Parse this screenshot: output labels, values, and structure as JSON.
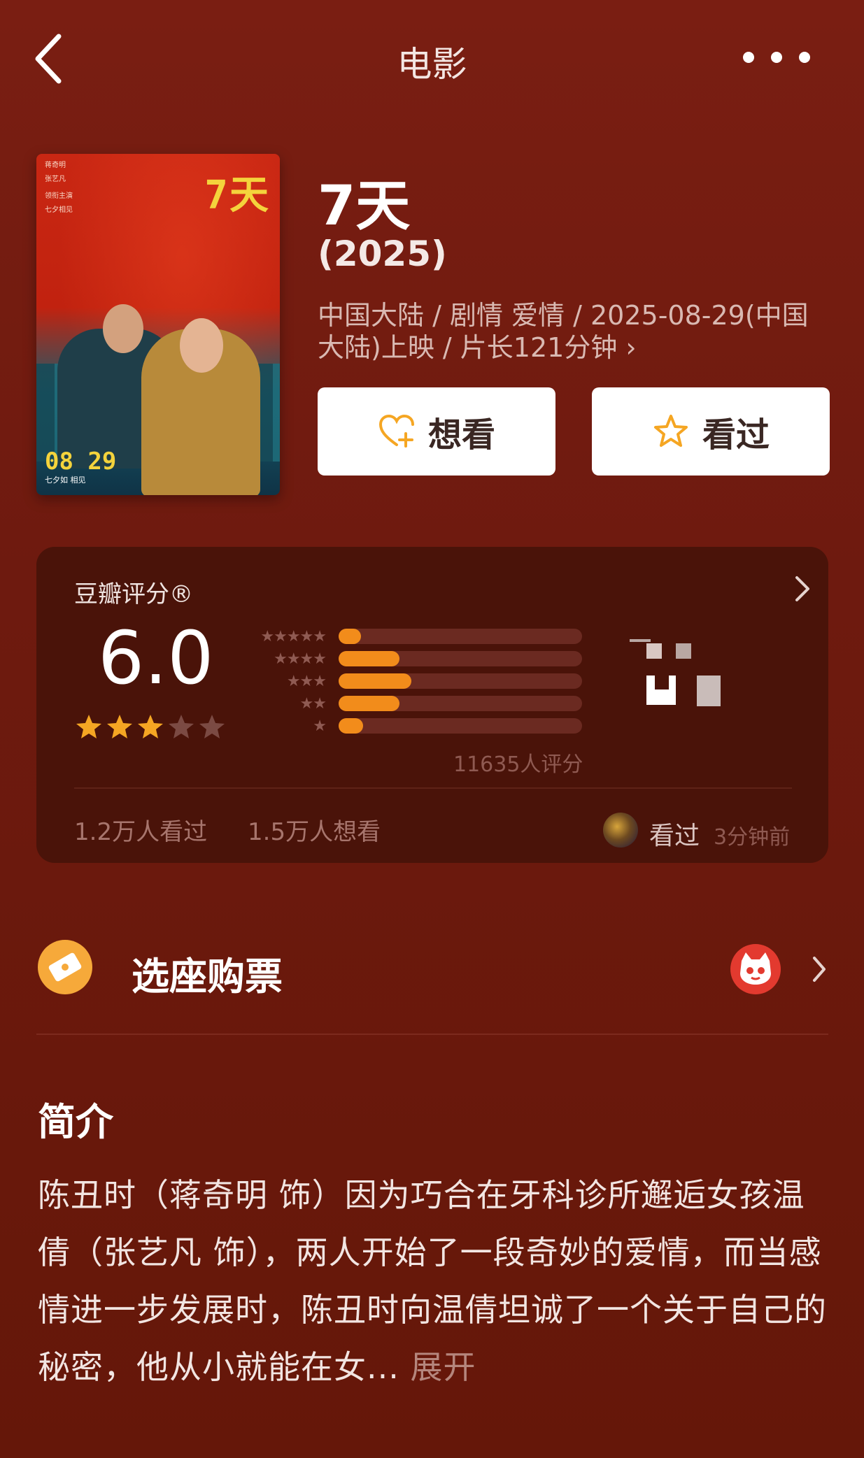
{
  "header": {
    "title": "电影",
    "back_icon": "chevron-left-icon",
    "more_icon": "more-dots-icon"
  },
  "poster": {
    "digits_top": "7天",
    "digits_bottom": "08 29",
    "caption": "七夕如 相见",
    "tiny_lines": [
      "蒋奇明",
      "张艺凡",
      "领衔主演",
      "七夕相见"
    ]
  },
  "movie": {
    "title": "7天",
    "year": "(2025)",
    "meta": "中国大陆 / 剧情 爱情 / 2025-08-29(中国大陆)上映 / 片长121分钟 ›"
  },
  "actions": {
    "want_label": "想看",
    "seen_label": "看过"
  },
  "rating": {
    "title": "豆瓣评分®",
    "score": "6.0",
    "stars_filled": 3,
    "stars_total": 5,
    "distribution": [
      {
        "stars": "★★★★★",
        "fraction": 0.09
      },
      {
        "stars": "★★★★",
        "fraction": 0.25
      },
      {
        "stars": "★★★",
        "fraction": 0.3
      },
      {
        "stars": "★★",
        "fraction": 0.25
      },
      {
        "stars": "★",
        "fraction": 0.1
      }
    ],
    "total": "11635人评分",
    "seen_count": "1.2万人看过",
    "want_count": "1.5万人想看",
    "friend_action": "看过",
    "friend_time": "3分钟前"
  },
  "ticket": {
    "label": "选座购票"
  },
  "intro": {
    "title": "简介",
    "text": "陈丑时（蒋奇明 饰）因为巧合在牙科诊所邂逅女孩温倩（张艺凡 饰），两人开始了一段奇妙的爱情，而当感情进一步发展时，陈丑时向温倩坦诚了一个关于自己的秘密，他从小就能在女...",
    "expand": " 展开"
  },
  "colors": {
    "accent": "#f28c1b",
    "background": "#7a1e12",
    "card": "#4a1309"
  }
}
